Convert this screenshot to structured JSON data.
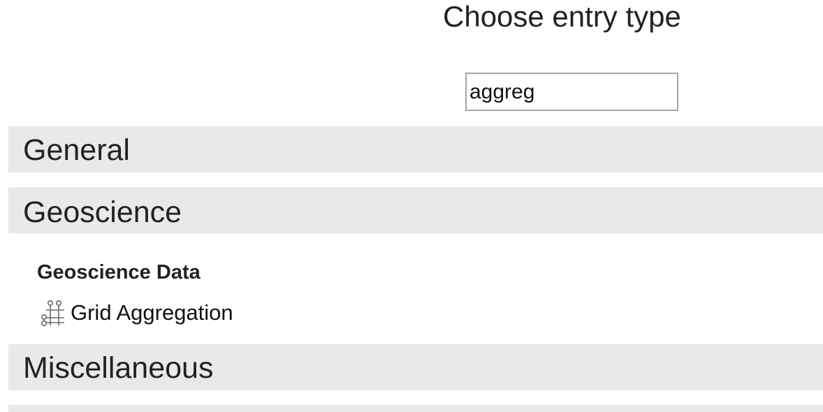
{
  "header": {
    "title": "Choose entry type"
  },
  "search": {
    "value": "aggreg"
  },
  "sections": {
    "general": "General",
    "geoscience": "Geoscience",
    "miscellaneous": "Miscellaneous"
  },
  "geoscience_group": {
    "heading": "Geoscience Data",
    "entries": [
      {
        "label": "Grid Aggregation",
        "icon": "grid-aggregation-icon"
      }
    ]
  }
}
